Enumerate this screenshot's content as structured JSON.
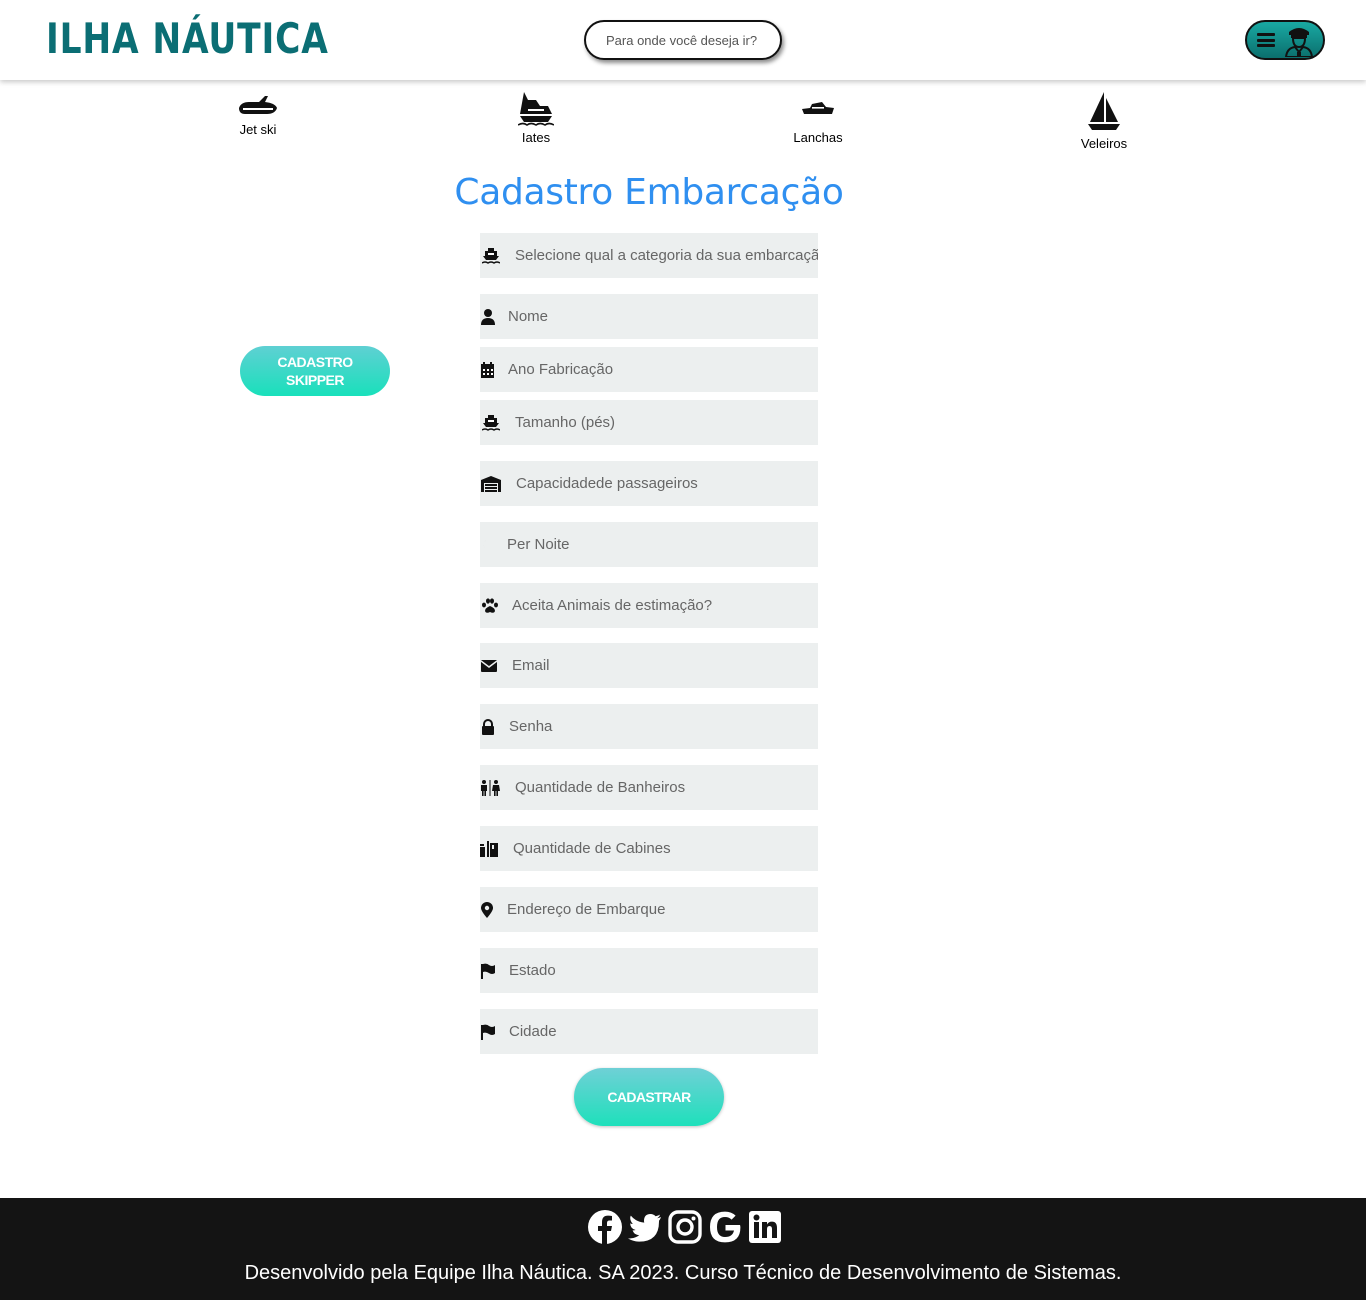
{
  "brand": {
    "name": "ILHA NÁUTICA",
    "color": "#0b6e74"
  },
  "header": {
    "search_placeholder": "Para onde você deseja ir?",
    "menu": {
      "hamburger_icon": "hamburger-icon",
      "avatar_icon": "captain-icon"
    }
  },
  "categories": [
    {
      "label": "Jet ski",
      "icon": "jetski-icon"
    },
    {
      "label": "Iates",
      "icon": "yacht-icon"
    },
    {
      "label": "Lanchas",
      "icon": "speedboat-icon"
    },
    {
      "label": "Veleiros",
      "icon": "sailboat-icon"
    }
  ],
  "page_title": "Cadastro Embarcação",
  "side_button": {
    "line1": "CADASTRO",
    "line2": "SKIPPER"
  },
  "form": {
    "fields": [
      {
        "placeholder": "Selecione qual a categoria da sua embarcação",
        "icon": "ship-icon"
      },
      {
        "placeholder": "Nome",
        "icon": "user-icon"
      },
      {
        "placeholder": "Ano Fabricação",
        "icon": "calendar-icon"
      },
      {
        "placeholder": "Tamanho (pés)",
        "icon": "ship-icon"
      },
      {
        "placeholder": "Capacidadede passageiros",
        "icon": "warehouse-icon"
      },
      {
        "placeholder": "Per Noite",
        "icon": "moon-icon"
      },
      {
        "placeholder": "Aceita Animais de estimação?",
        "icon": "paw-icon"
      },
      {
        "placeholder": "Email",
        "icon": "envelope-icon"
      },
      {
        "placeholder": "Senha",
        "icon": "lock-icon"
      },
      {
        "placeholder": "Quantidade de Banheiros",
        "icon": "restroom-icon"
      },
      {
        "placeholder": "Quantidade de Cabines",
        "icon": "cabin-icon"
      },
      {
        "placeholder": "Endereço de Embarque",
        "icon": "location-pin-icon"
      },
      {
        "placeholder": "Estado",
        "icon": "flag-icon"
      },
      {
        "placeholder": "Cidade",
        "icon": "flag-icon"
      }
    ],
    "submit_label": "CADASTRAR"
  },
  "footer": {
    "socials": [
      "facebook-icon",
      "twitter-icon",
      "instagram-icon",
      "google-icon",
      "linkedin-icon"
    ],
    "credits": "Desenvolvido pela Equipe Ilha Náutica. SA 2023. Curso Técnico de Desenvolvimento de Sistemas."
  },
  "colors": {
    "title": "#2f8ff0",
    "button_top": "#5fd0d3",
    "button_bottom": "#19e0bb",
    "footer_bg": "#141414",
    "field_bg": "#ecefef"
  }
}
